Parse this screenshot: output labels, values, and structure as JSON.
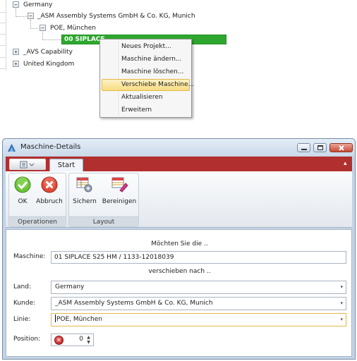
{
  "tree": {
    "nodes": [
      {
        "label": "Germany",
        "expander": "−"
      },
      {
        "label": "_ASM Assembly Systems GmbH & Co. KG, Munich",
        "expander": "−"
      },
      {
        "label": "POE, München",
        "expander": "−"
      },
      {
        "label": "00 SIPLACE",
        "selected": true
      },
      {
        "label": "_AVS Capability",
        "expander": "+"
      },
      {
        "label": "United Kingdom",
        "expander": "+"
      }
    ]
  },
  "context_menu": {
    "items": [
      {
        "label": "Neues Projekt..."
      },
      {
        "label": "Maschine ändern..."
      },
      {
        "label": "Maschine löschen..."
      },
      {
        "label": "Verschiebe Maschine...",
        "highlighted": true
      },
      {
        "label": "Aktualisieren"
      },
      {
        "label": "Erweitern"
      }
    ]
  },
  "window": {
    "title": "Maschine-Details",
    "ribbon": {
      "tab": "Start",
      "groups": [
        {
          "label": "Operationen",
          "buttons": [
            {
              "label": "OK",
              "icon": "ok-check-icon"
            },
            {
              "label": "Abbruch",
              "icon": "cancel-x-icon"
            }
          ]
        },
        {
          "label": "Layout",
          "buttons": [
            {
              "label": "Sichern",
              "icon": "save-layout-icon"
            },
            {
              "label": "Bereinigen",
              "icon": "clear-layout-icon"
            }
          ]
        }
      ]
    },
    "form": {
      "prompt_top": "Möchten Sie die ..",
      "prompt_middle": "verschieben nach ..",
      "maschine_label": "Maschine:",
      "maschine_value": "01 SIPLACE S25 HM / 1133-12018039",
      "land_label": "Land:",
      "land_value": "Germany",
      "kunde_label": "Kunde:",
      "kunde_value": "_ASM Assembly Systems GmbH & Co. KG, Munich",
      "linie_label": "Linie:",
      "linie_value": "POE, München",
      "position_label": "Position:",
      "position_value": "0"
    }
  },
  "colors": {
    "selection_green": "#2fa72f",
    "ribbon_red": "#b22f2f",
    "menu_highlight": "#f9dd82"
  }
}
